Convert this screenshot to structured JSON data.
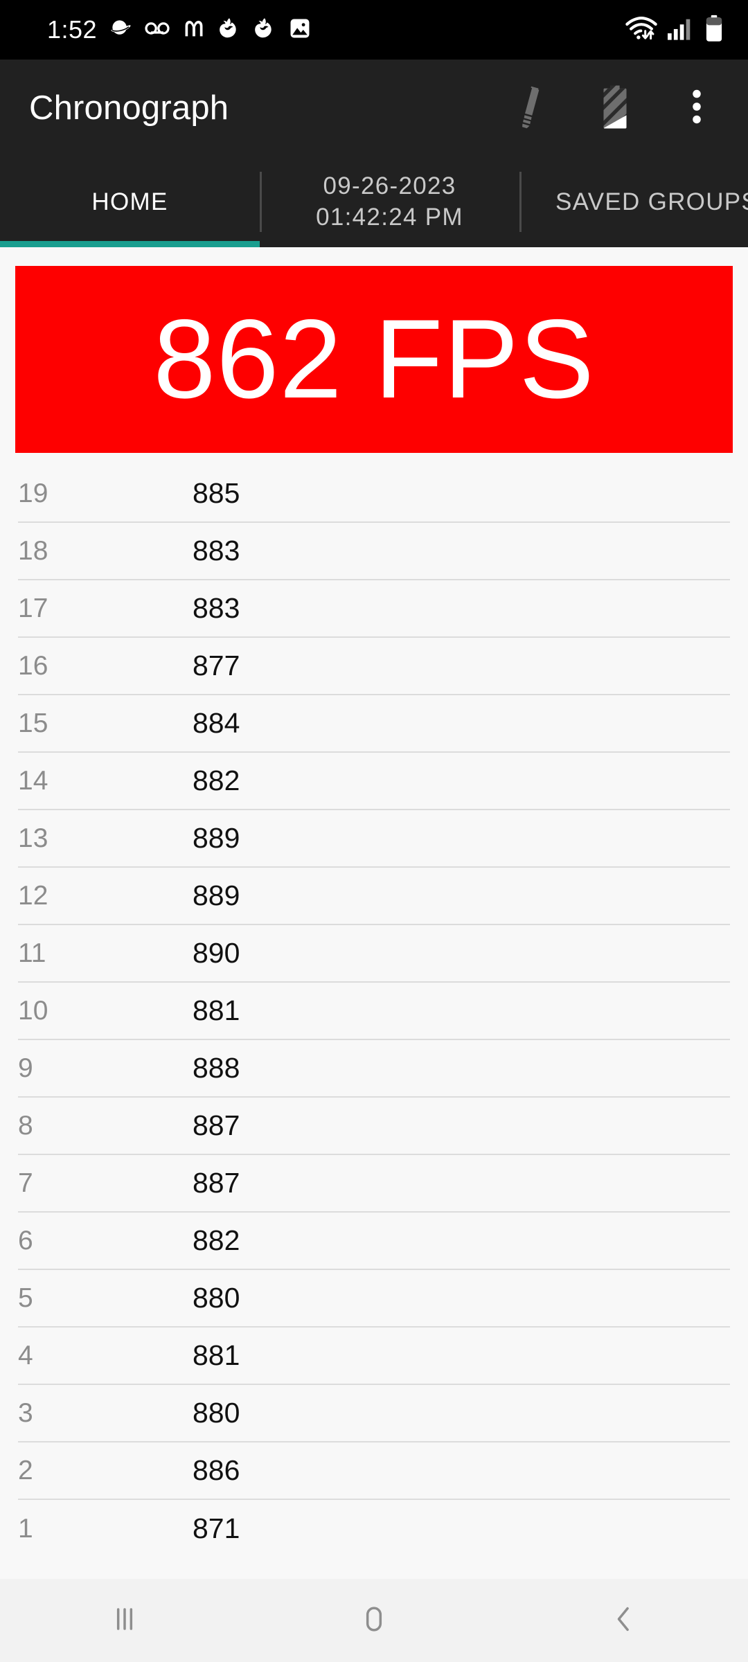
{
  "status_bar": {
    "clock": "1:52",
    "left_icons": [
      "browser-planet-icon",
      "voicemail-icon",
      "mcdonalds-icon",
      "firefox-icon",
      "firefox-icon",
      "gallery-image-icon"
    ],
    "right_icons": [
      "wifi-icon",
      "cellular-signal-icon",
      "battery-icon"
    ]
  },
  "app_bar": {
    "title": "Chronograph",
    "actions": [
      {
        "name": "edit-pencil-button"
      },
      {
        "name": "battery-status-button"
      },
      {
        "name": "overflow-menu-button"
      }
    ]
  },
  "tabs": {
    "home_label": "HOME",
    "date_line1": "09-26-2023",
    "date_line2": "01:42:24 PM",
    "saved_groups_label": "SAVED GROUPS",
    "active": "HOME",
    "indicator_color": "#1A9E8F"
  },
  "fps_banner": {
    "value": "862",
    "unit": "FPS",
    "display": "862 FPS",
    "background_color": "#FE0000",
    "text_color": "#FFFFFF"
  },
  "readings": {
    "rows": [
      {
        "index": "19",
        "value": "885"
      },
      {
        "index": "18",
        "value": "883"
      },
      {
        "index": "17",
        "value": "883"
      },
      {
        "index": "16",
        "value": "877"
      },
      {
        "index": "15",
        "value": "884"
      },
      {
        "index": "14",
        "value": "882"
      },
      {
        "index": "13",
        "value": "889"
      },
      {
        "index": "12",
        "value": "889"
      },
      {
        "index": "11",
        "value": "890"
      },
      {
        "index": "10",
        "value": "881"
      },
      {
        "index": "9",
        "value": "888"
      },
      {
        "index": "8",
        "value": "887"
      },
      {
        "index": "7",
        "value": "887"
      },
      {
        "index": "6",
        "value": "882"
      },
      {
        "index": "5",
        "value": "880"
      },
      {
        "index": "4",
        "value": "881"
      },
      {
        "index": "3",
        "value": "880"
      },
      {
        "index": "2",
        "value": "886"
      },
      {
        "index": "1",
        "value": "871"
      }
    ]
  },
  "nav_bar": {
    "buttons": [
      "recents-button",
      "home-button",
      "back-button"
    ]
  }
}
